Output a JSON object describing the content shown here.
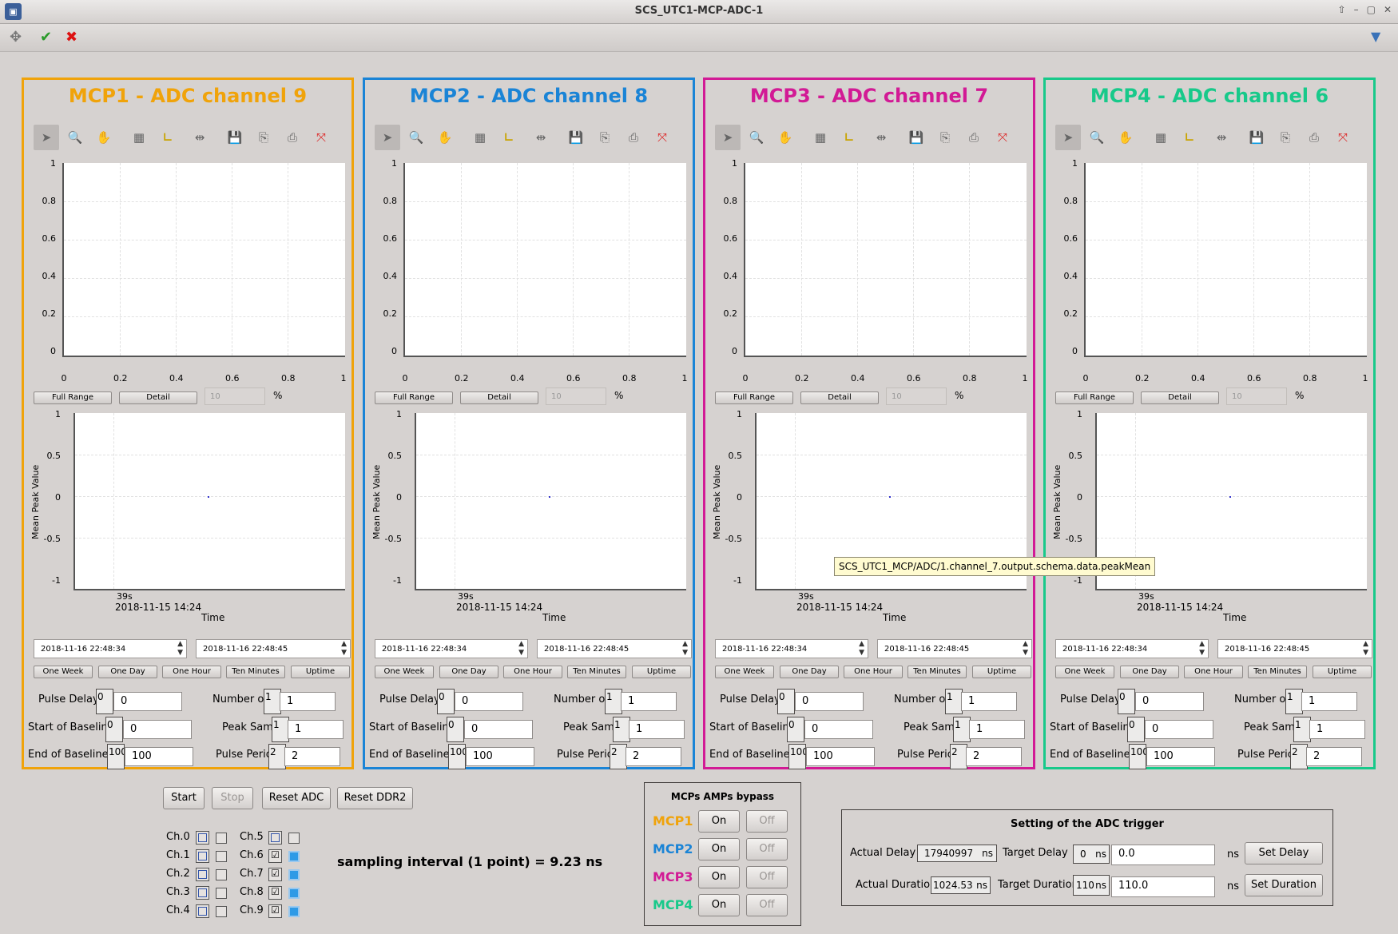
{
  "window": {
    "title": "SCS_UTC1-MCP-ADC-1"
  },
  "panels": [
    {
      "title": "MCP1 - ADC channel 9",
      "color": "#f0a30a",
      "full_range": "Full Range",
      "detail": "Detail",
      "percent_value": "10",
      "percent_sign": "%",
      "ytick_top": [
        "1",
        "0.8",
        "0.6",
        "0.4",
        "0.2",
        "0"
      ],
      "xtick_top": [
        "0",
        "0.2",
        "0.4",
        "0.6",
        "0.8",
        "1"
      ],
      "ylabel": "Mean Peak Value",
      "ytick_bottom": [
        "1",
        "0.5",
        "0",
        "-0.5",
        "-1"
      ],
      "xtick_bottom": "39s",
      "xtick_date": "2018-11-15 14:24",
      "xlabel": "Time",
      "date_from": "2018-11-16 22:48:34",
      "date_to": "2018-11-16 22:48:45",
      "range_buttons": [
        "One Week",
        "One Day",
        "One Hour",
        "Ten Minutes",
        "Uptime"
      ],
      "pulse_delay": "Pulse Delay",
      "pulse_delay_val": "0",
      "pulse_delay_in": "0",
      "num_pulse": "Number of pulse",
      "num_pulse_val": "1",
      "num_pulse_in": "1",
      "start_base": "Start of Baseline",
      "start_base_val": "0",
      "start_base_in": "0",
      "peak_samples": "Peak Samples",
      "peak_samples_val": "1",
      "peak_samples_in": "1",
      "end_base": "End of Baseline",
      "end_base_val": "100",
      "end_base_in": "100",
      "pulse_period": "Pulse Period",
      "pulse_period_val": "2",
      "pulse_period_in": "2"
    },
    {
      "title": "MCP2 - ADC channel 8",
      "color": "#1a84d6",
      "full_range": "Full Range",
      "detail": "Detail",
      "percent_value": "10",
      "percent_sign": "%",
      "ytick_top": [
        "1",
        "0.8",
        "0.6",
        "0.4",
        "0.2",
        "0"
      ],
      "xtick_top": [
        "0",
        "0.2",
        "0.4",
        "0.6",
        "0.8",
        "1"
      ],
      "ylabel": "Mean Peak Value",
      "ytick_bottom": [
        "1",
        "0.5",
        "0",
        "-0.5",
        "-1"
      ],
      "xtick_bottom": "39s",
      "xtick_date": "2018-11-15 14:24",
      "xlabel": "Time",
      "date_from": "2018-11-16 22:48:34",
      "date_to": "2018-11-16 22:48:45",
      "range_buttons": [
        "One Week",
        "One Day",
        "One Hour",
        "Ten Minutes",
        "Uptime"
      ],
      "pulse_delay": "Pulse Delay",
      "pulse_delay_val": "0",
      "pulse_delay_in": "0",
      "num_pulse": "Number of puls",
      "num_pulse_val": "1",
      "num_pulse_in": "1",
      "start_base": "Start of Baselin",
      "start_base_val": "0",
      "start_base_in": "0",
      "peak_samples": "Peak Samples",
      "peak_samples_val": "1",
      "peak_samples_in": "1",
      "end_base": "End of Baseline",
      "end_base_val": "100",
      "end_base_in": "100",
      "pulse_period": "Pulse Period",
      "pulse_period_val": "2",
      "pulse_period_in": "2"
    },
    {
      "title": "MCP3 - ADC channel 7",
      "color": "#d21a95",
      "full_range": "Full Range",
      "detail": "Detail",
      "percent_value": "10",
      "percent_sign": "%",
      "ytick_top": [
        "1",
        "0.8",
        "0.6",
        "0.4",
        "0.2",
        "0"
      ],
      "xtick_top": [
        "0",
        "0.2",
        "0.4",
        "0.6",
        "0.8",
        "1"
      ],
      "ylabel": "Mean Peak Value",
      "ytick_bottom": [
        "1",
        "0.5",
        "0",
        "-0.5",
        "-1"
      ],
      "xtick_bottom": "39s",
      "xtick_date": "2018-11-15 14:24",
      "xlabel": "Time",
      "date_from": "2018-11-16 22:48:34",
      "date_to": "2018-11-16 22:48:45",
      "range_buttons": [
        "One Week",
        "One Day",
        "One Hour",
        "Ten Minutes",
        "Uptime"
      ],
      "pulse_delay": "Pulse Delay",
      "pulse_delay_val": "0",
      "pulse_delay_in": "0",
      "num_pulse": "Number of pulse",
      "num_pulse_val": "1",
      "num_pulse_in": "1",
      "start_base": "Start of Baseline",
      "start_base_val": "0",
      "start_base_in": "0",
      "peak_samples": "Peak Samples",
      "peak_samples_val": "1",
      "peak_samples_in": "1",
      "end_base": "End of Baseline",
      "end_base_val": "100",
      "end_base_in": "100",
      "pulse_period": "Pulse Period",
      "pulse_period_val": "2",
      "pulse_period_in": "2"
    },
    {
      "title": "MCP4 - ADC channel 6",
      "color": "#18c98a",
      "full_range": "Full Range",
      "detail": "Detail",
      "percent_value": "10",
      "percent_sign": "%",
      "ytick_top": [
        "1",
        "0.8",
        "0.6",
        "0.4",
        "0.2",
        "0"
      ],
      "xtick_top": [
        "0",
        "0.2",
        "0.4",
        "0.6",
        "0.8",
        "1"
      ],
      "ylabel": "Mean Peak Value",
      "ytick_bottom": [
        "1",
        "0.5",
        "0",
        "-0.5",
        "-1"
      ],
      "xtick_bottom": "39s",
      "xtick_date": "2018-11-15 14:24",
      "xlabel": "Time",
      "date_from": "2018-11-16 22:48:34",
      "date_to": "2018-11-16 22:48:45",
      "range_buttons": [
        "One Week",
        "One Day",
        "One Hour",
        "Ten Minutes",
        "Uptime"
      ],
      "pulse_delay": "Pulse Delay",
      "pulse_delay_val": "0",
      "pulse_delay_in": "0",
      "num_pulse": "Number of puls",
      "num_pulse_val": "1",
      "num_pulse_in": "1",
      "start_base": "Start of Baseline",
      "start_base_val": "0",
      "start_base_in": "0",
      "peak_samples": "Peak Samples",
      "peak_samples_val": "1",
      "peak_samples_in": "1",
      "end_base": "End of Baseline",
      "end_base_val": "100",
      "end_base_in": "100",
      "pulse_period": "Pulse Period",
      "pulse_period_val": "2",
      "pulse_period_in": "2"
    }
  ],
  "tooltip": "SCS_UTC1_MCP/ADC/1.channel_7.output.schema.data.peakMean",
  "controls": {
    "start": "Start",
    "stop": "Stop",
    "reset_adc": "Reset ADC",
    "reset_ddr2": "Reset DDR2"
  },
  "channels_left": [
    {
      "label": "Ch.0",
      "checked": false,
      "active": false
    },
    {
      "label": "Ch.1",
      "checked": false,
      "active": false
    },
    {
      "label": "Ch.2",
      "checked": false,
      "active": false
    },
    {
      "label": "Ch.3",
      "checked": false,
      "active": false
    },
    {
      "label": "Ch.4",
      "checked": false,
      "active": false
    }
  ],
  "channels_right": [
    {
      "label": "Ch.5",
      "checked": false,
      "active": false
    },
    {
      "label": "Ch.6",
      "checked": true,
      "active": true
    },
    {
      "label": "Ch.7",
      "checked": true,
      "active": true
    },
    {
      "label": "Ch.8",
      "checked": true,
      "active": true
    },
    {
      "label": "Ch.9",
      "checked": true,
      "active": true
    }
  ],
  "sampling": "sampling interval (1 point) = 9.23 ns",
  "bypass": {
    "title": "MCPs AMPs bypass",
    "rows": [
      {
        "label": "MCP1",
        "color": "#f0a30a",
        "on": "On",
        "off": "Off"
      },
      {
        "label": "MCP2",
        "color": "#1a84d6",
        "on": "On",
        "off": "Off"
      },
      {
        "label": "MCP3",
        "color": "#d21a95",
        "on": "On",
        "off": "Off"
      },
      {
        "label": "MCP4",
        "color": "#18c98a",
        "on": "On",
        "off": "Off"
      }
    ]
  },
  "trigger": {
    "title": "Setting of the ADC trigger",
    "actual_delay": "Actual Delay",
    "actual_delay_val": "17940997",
    "ns": "ns",
    "target_delay": "Target Delay",
    "target_delay_val": "0",
    "target_delay_in": "0.0",
    "set_delay": "Set Delay",
    "actual_duration": "Actual Duration",
    "actual_duration_val": "1024.53",
    "target_duration": "Target Duration",
    "target_duration_val": "110",
    "target_duration_in": "110.0",
    "set_duration": "Set Duration"
  }
}
